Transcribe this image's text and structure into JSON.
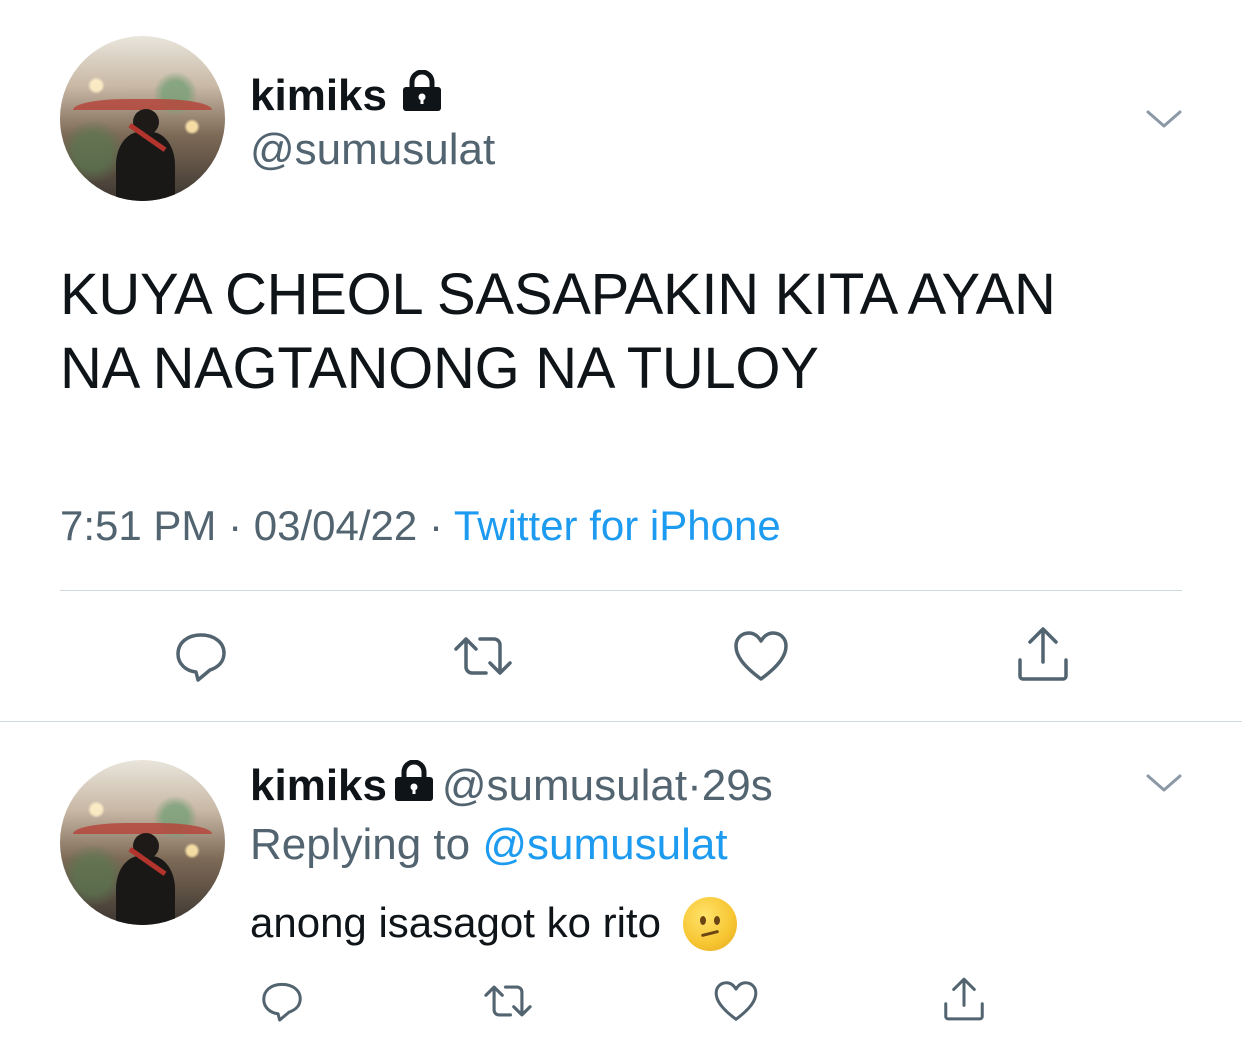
{
  "main_tweet": {
    "display_name": "kimiks",
    "handle": "@sumusulat",
    "text_line1": "KUYA CHEOL SASAPAKIN KITA AYAN",
    "text_line2": "NA NAGTANONG NA TULOY",
    "time": "7:51 PM",
    "sep1": "·",
    "date": "03/04/22",
    "sep2": "·",
    "source": "Twitter for iPhone"
  },
  "reply_tweet": {
    "display_name": "kimiks",
    "handle": "@sumusulat",
    "sep": "·",
    "age": "29s",
    "replying_prefix": "Replying to",
    "replying_handle": "@sumusulat",
    "text": "anong isasagot ko rito"
  },
  "icons": {
    "lock": "lock-icon",
    "more": "chevron-down-icon",
    "reply": "reply-icon",
    "retweet": "retweet-icon",
    "like": "heart-icon",
    "share": "share-icon",
    "emoji": "confused-face-emoji"
  },
  "colors": {
    "text": "#0f1419",
    "secondary": "#536471",
    "link": "#1d9bf0",
    "divider": "#cfd9de"
  }
}
